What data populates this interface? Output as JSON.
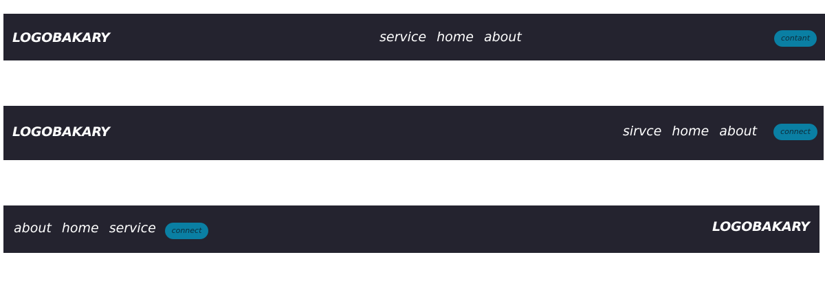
{
  "navbars": [
    {
      "logo": "LOGOBAKARY",
      "links": [
        "service",
        "home",
        "about"
      ],
      "button": "contant"
    },
    {
      "logo": "LOGOBAKARY",
      "links": [
        "sirvce",
        "home",
        "about"
      ],
      "button": "connect"
    },
    {
      "logo": "LOGOBAKARY",
      "links": [
        "about",
        "home",
        "service"
      ],
      "button": "connect"
    }
  ],
  "colors": {
    "navbar_bg": "#24232f",
    "button_bg": "#0a7fa3",
    "text": "#ffffff",
    "button_text": "#0d2b3a"
  }
}
